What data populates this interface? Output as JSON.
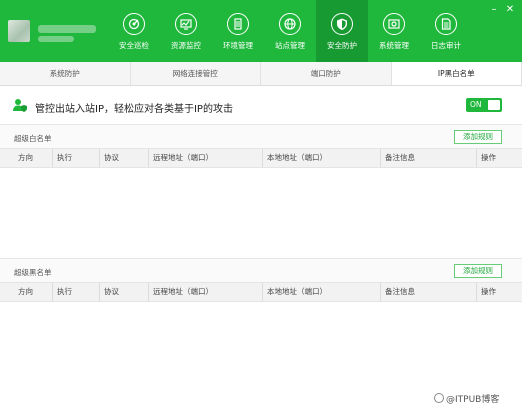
{
  "window": {
    "min_glyph": "–",
    "close_glyph": "✕"
  },
  "nav": {
    "items": [
      {
        "label": "安全巡检",
        "icon": "radar-icon"
      },
      {
        "label": "资源监控",
        "icon": "monitor-chart-icon"
      },
      {
        "label": "环境管理",
        "icon": "server-icon"
      },
      {
        "label": "站点管理",
        "icon": "globe-icon"
      },
      {
        "label": "安全防护",
        "icon": "shield-icon",
        "active": true
      },
      {
        "label": "系统管理",
        "icon": "system-icon"
      },
      {
        "label": "日志审计",
        "icon": "document-icon"
      }
    ]
  },
  "tabs": [
    {
      "label": "系统防护"
    },
    {
      "label": "网络连接管控"
    },
    {
      "label": "端口防护"
    },
    {
      "label": "IP黑白名单",
      "active": true
    }
  ],
  "banner": {
    "text": "管控出站入站IP，轻松应对各类基于IP的攻击",
    "toggle_label": "ON"
  },
  "whitelist": {
    "title": "超级白名单",
    "add_label": "添加规则"
  },
  "blacklist": {
    "title": "超级黑名单",
    "add_label": "添加规则"
  },
  "columns": [
    "方向",
    "执行",
    "协议",
    "远程地址（端口）",
    "本地地址（端口）",
    "备注信息",
    "操作"
  ],
  "watermark": "@ITPUB博客",
  "colors": {
    "brand": "#1fb83c",
    "brand_active": "#189a32",
    "button_border": "#66cc77"
  }
}
